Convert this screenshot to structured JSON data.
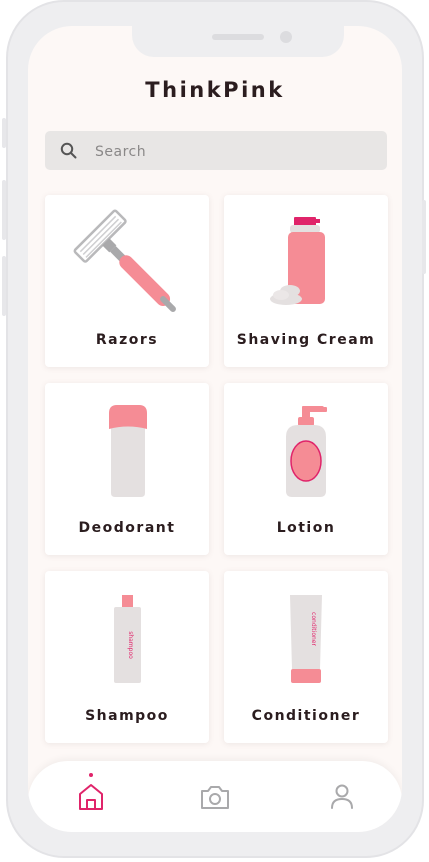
{
  "app": {
    "title": "ThinkPink"
  },
  "search": {
    "placeholder": "Search"
  },
  "categories": [
    {
      "label": "Razors",
      "icon": "razor-icon"
    },
    {
      "label": "Shaving Cream",
      "icon": "shaving-cream-icon"
    },
    {
      "label": "Deodorant",
      "icon": "deodorant-icon"
    },
    {
      "label": "Lotion",
      "icon": "lotion-icon"
    },
    {
      "label": "Shampoo",
      "icon": "shampoo-icon"
    },
    {
      "label": "Conditioner",
      "icon": "conditioner-icon"
    }
  ],
  "product_text": {
    "shampoo": "shampoo",
    "conditioner": "conditioner"
  },
  "bottom_nav": {
    "active": "home",
    "items": [
      {
        "id": "home",
        "icon": "home-icon"
      },
      {
        "id": "camera",
        "icon": "camera-icon"
      },
      {
        "id": "profile",
        "icon": "profile-icon"
      }
    ]
  },
  "colors": {
    "accent": "#e0246a",
    "pink": "#f58c95",
    "grey_product": "#e4e0e0",
    "background": "#fdf8f6",
    "frame": "#eeeef0"
  }
}
